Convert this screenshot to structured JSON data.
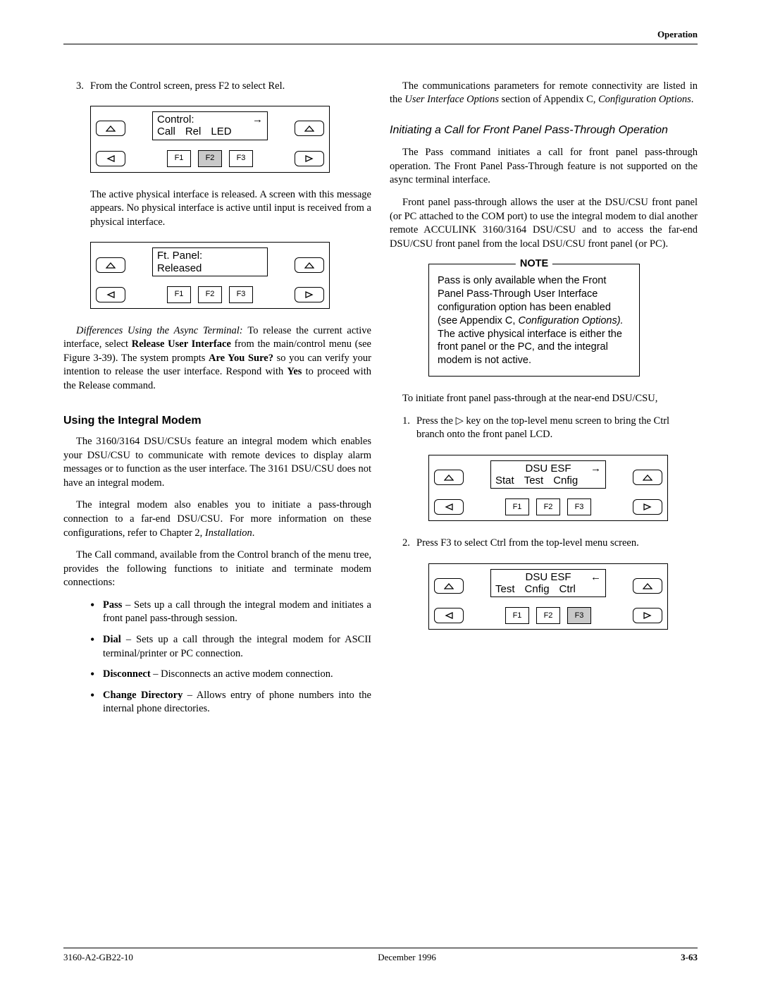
{
  "header": {
    "section": "Operation"
  },
  "left": {
    "step3_num": "3.",
    "step3_text": "From the Control screen, press F2 to select Rel.",
    "panel1": {
      "line1": "Control:",
      "opts": [
        "Call",
        "Rel",
        "LED"
      ],
      "arrow": "→",
      "fkeys": [
        "F1",
        "F2",
        "F3"
      ],
      "highlight": 1
    },
    "para_after_panel1": "The active physical interface is released. A screen with this message appears. No physical interface is active until input is received from a physical interface.",
    "panel2": {
      "line1": "Ft. Panel:",
      "line2": "Released",
      "fkeys": [
        "F1",
        "F2",
        "F3"
      ],
      "highlight": -1
    },
    "diff_para_lead": "Differences Using the Async Terminal: ",
    "diff_para_a": "To release the current active interface, select ",
    "diff_para_bold": "Release User Interface",
    "diff_para_b": " from the main/control menu (see Figure 3-39). The system prompts ",
    "diff_para_bold2": "Are You Sure?",
    "diff_para_c": " so you can verify your intention to release the user interface. Respond with ",
    "diff_para_bold3": "Yes",
    "diff_para_d": " to proceed with the Release command.",
    "h2": "Using the Integral Modem",
    "modem_p1": "The 3160/3164 DSU/CSUs feature an integral modem which enables your DSU/CSU to communicate with remote devices to display alarm messages or to function as the user interface. The 3161 DSU/CSU does not have an integral modem.",
    "modem_p2a": "The integral modem also enables you to initiate a pass-through connection to a far-end DSU/CSU. For more information on these configurations, refer to Chapter 2, ",
    "modem_p2b": "Installation",
    "modem_p2c": ".",
    "modem_p3": "The Call command, available from the Control branch of the menu tree, provides the following functions to initiate and terminate modem connections:",
    "bullets": [
      {
        "b": "Pass",
        "t": " – Sets up a call through the integral modem and initiates a front panel pass-through session."
      },
      {
        "b": "Dial",
        "t": " – Sets up a call through the integral modem for ASCII terminal/printer or PC connection."
      },
      {
        "b": "Disconnect",
        "t": " – Disconnects an active modem connection."
      },
      {
        "b": "Change Directory",
        "t": " – Allows entry of phone numbers into the internal phone directories."
      }
    ]
  },
  "right": {
    "intro_a": "The communications parameters for remote connectivity are listed in the ",
    "intro_i1": "User Interface Options",
    "intro_b": " section of Appendix C, ",
    "intro_i2": "Configuration Options",
    "intro_c": ".",
    "h2": "Initiating a Call for Front Panel Pass-Through Operation",
    "p1": "The Pass command initiates a call for front panel pass-through operation. The Front Panel Pass-Through feature is not supported on the async terminal interface.",
    "p2": "Front panel pass-through allows the user at the DSU/CSU front panel (or PC attached to the COM port) to use the integral modem to dial another remote ACCULINK 3160/3164 DSU/CSU and to access the far-end DSU/CSU front panel from the local DSU/CSU front panel (or PC).",
    "note_title": "NOTE",
    "note_a": "Pass is only available when the Front Panel Pass-Through User Interface configuration option has been enabled (see Appendix C, ",
    "note_i": "Configuration Options).",
    "note_b": " The active physical interface is either the front panel or the PC, and the integral modem is not active.",
    "p3": "To initiate front panel pass-through at the near-end DSU/CSU,",
    "step1_num": "1.",
    "step1_a": "Press the ",
    "step1_icon": "▷",
    "step1_b": " key on the top-level menu screen to bring the Ctrl branch onto the front panel LCD.",
    "panel3": {
      "title": "DSU ESF",
      "opts": [
        "Stat",
        "Test",
        "Cnfig"
      ],
      "arrow": "→",
      "fkeys": [
        "F1",
        "F2",
        "F3"
      ],
      "highlight": -1
    },
    "step2_num": "2.",
    "step2_text": "Press F3 to select Ctrl from the top-level menu screen.",
    "panel4": {
      "title": "DSU ESF",
      "opts": [
        "Test",
        "Cnfig",
        "Ctrl"
      ],
      "arrow": "←",
      "fkeys": [
        "F1",
        "F2",
        "F3"
      ],
      "highlight": 2
    }
  },
  "footer": {
    "left": "3160-A2-GB22-10",
    "center": "December 1996",
    "right": "3-63"
  },
  "glyphs": {
    "tri_up": "△",
    "tri_outline_up": "△",
    "tri_left": "◁",
    "tri_right": "▷"
  }
}
